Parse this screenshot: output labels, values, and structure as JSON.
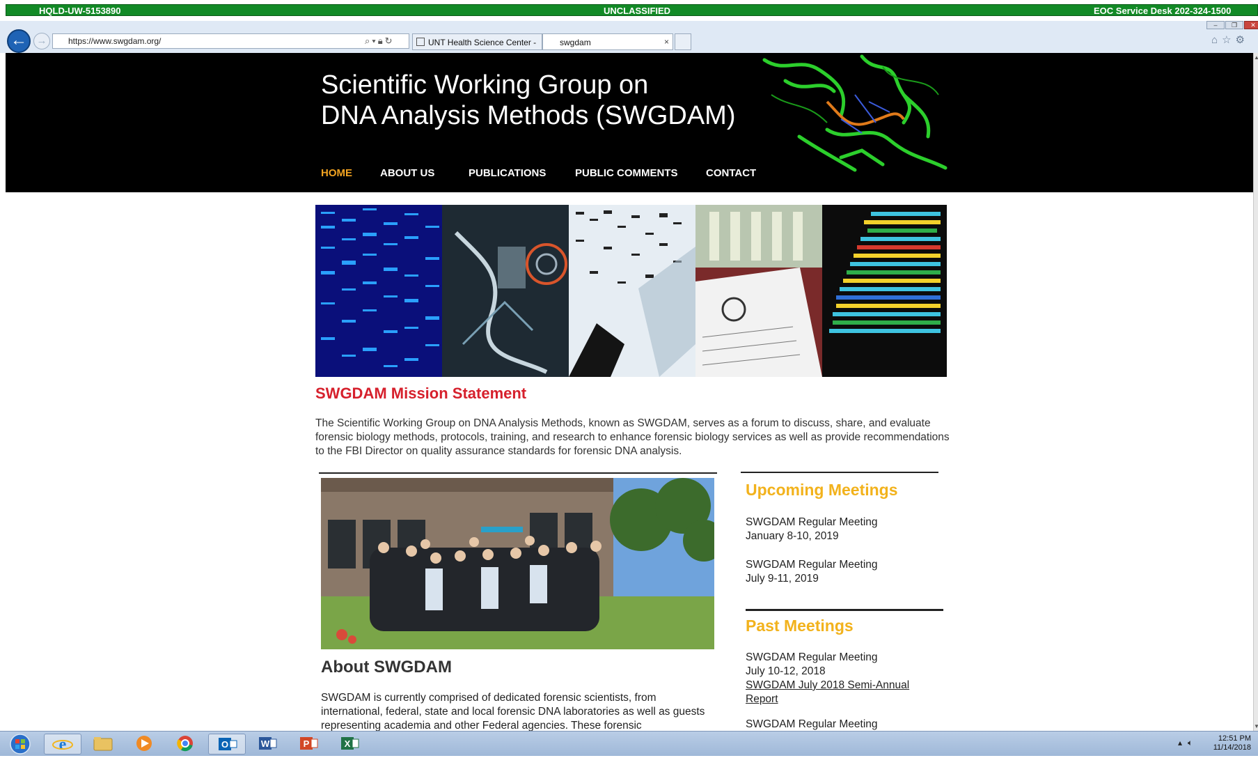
{
  "banner": {
    "left": "HQLD-UW-5153890",
    "center": "UNCLASSIFIED",
    "right": "EOC Service Desk 202-324-1500",
    "color": "#128a26"
  },
  "browser": {
    "url": "https://www.swgdam.org/",
    "tabs": [
      {
        "label": "UNT Health Science Center - ...",
        "active": false
      },
      {
        "label": "swgdam",
        "active": true
      }
    ],
    "icons": [
      "back-icon",
      "forward-icon",
      "search-icon",
      "lock-icon",
      "refresh-icon",
      "home-icon",
      "star-icon",
      "gear-icon"
    ]
  },
  "site": {
    "title_line1": "Scientific Working Group on",
    "title_line2": "DNA Analysis Methods (SWGDAM)",
    "nav": [
      "HOME",
      "ABOUT US",
      "PUBLICATIONS",
      "PUBLIC COMMENTS",
      "CONTACT"
    ],
    "active_nav": "HOME",
    "accent_color": "#f2a321",
    "mission_title": "SWGDAM Mission Statement",
    "mission_text": "The Scientific Working Group on DNA Analysis Methods, known as SWGDAM, serves as a forum to discuss, share, and evaluate forensic biology methods, protocols, training, and research to enhance forensic biology services as well as provide recommendations to the FBI Director on quality assurance standards for forensic DNA analysis.",
    "about_title": "About SWGDAM",
    "about_text": "SWGDAM is currently comprised of dedicated forensic scientists, from international, federal, state and local forensic DNA laboratories as well as guests representing academia and other Federal agencies. These forensic",
    "upcoming_title": "Upcoming Meetings",
    "upcoming": [
      {
        "name": "SWGDAM Regular Meeting",
        "date": "January 8-10, 2019"
      },
      {
        "name": "SWGDAM Regular Meeting",
        "date": "July 9-11, 2019"
      }
    ],
    "past_title": "Past Meetings",
    "past": [
      {
        "name": "SWGDAM Regular Meeting",
        "date": "July 10-12, 2018",
        "link": "SWGDAM July 2018 Semi-Annual Report"
      },
      {
        "name": "SWGDAM Regular Meeting"
      }
    ]
  },
  "taskbar": {
    "apps": [
      "start-orb",
      "internet-explorer",
      "file-explorer",
      "media-player",
      "chrome",
      "outlook",
      "word",
      "powerpoint",
      "excel"
    ],
    "time": "12:51 PM",
    "date": "11/14/2018"
  }
}
